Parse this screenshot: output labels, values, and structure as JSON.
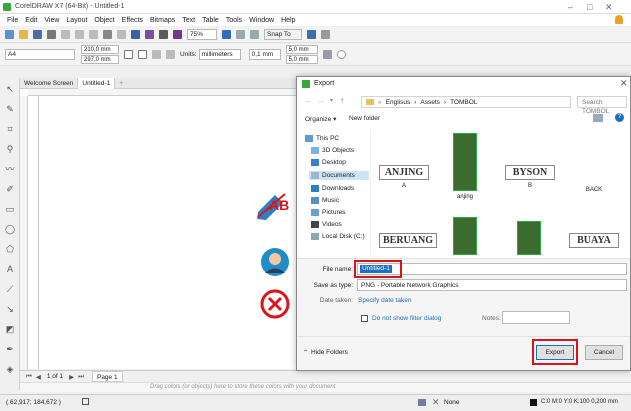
{
  "app": {
    "title": "CorelDRAW X7 (64-Bit) - Untitled-1"
  },
  "menu": [
    "File",
    "Edit",
    "View",
    "Layout",
    "Object",
    "Effects",
    "Bitmaps",
    "Text",
    "Table",
    "Tools",
    "Window",
    "Help"
  ],
  "toolbar": {
    "zoom": "75%",
    "snap": "Snap To",
    "width": "210,0 mm",
    "height": "297,0 mm",
    "units_label": "Units:",
    "units": "millimeters",
    "nudge": "0,1 mm",
    "dup_x": "5,0 mm",
    "dup_y": "5,0 mm",
    "paper": "A4"
  },
  "tabs": [
    "Welcome Screen",
    "Untitled-1"
  ],
  "pagenav": {
    "count": "1 of 1",
    "page": "Page 1"
  },
  "colorstrip": {
    "hint": "Drag colors (or objects) here to store these colors with your document"
  },
  "status": {
    "coords": "( 62,917; 184,672 )",
    "fill": "None",
    "outline": "C:0 M:0 Y:0 K:100  0,200 mm"
  },
  "dialog": {
    "title": "Export",
    "breadcrumb": [
      "Englisus",
      "Assets",
      "TOMBOL"
    ],
    "search_placeholder": "Search TOMBOL",
    "organize": "Organize ▾",
    "new_folder": "New folder",
    "nav": [
      "This PC",
      "3D Objects",
      "Desktop",
      "Documents",
      "Downloads",
      "Music",
      "Pictures",
      "Videos",
      "Local Disk (C:)"
    ],
    "files": [
      {
        "word": "ANJING",
        "label": "A"
      },
      {
        "label": "anjing"
      },
      {
        "word": "BYSON",
        "label": "B"
      },
      {
        "label": "BACK"
      },
      {
        "word": "BERUANG",
        "label": ""
      },
      {
        "label": ""
      },
      {
        "label": ""
      },
      {
        "word": "BUAYA",
        "label": ""
      }
    ],
    "file_name_label": "File name:",
    "file_name": "Untitled-1",
    "save_type_label": "Save as type:",
    "save_type": "PNG - Portable Network Graphics",
    "date_label": "Date taken:",
    "date_value": "Specify date taken",
    "filter_label": "Do not show filter dialog",
    "notes_label": "Notes:",
    "hide_folders": "Hide Folders",
    "export": "Export",
    "cancel": "Cancel"
  },
  "colors": {
    "accent": "#1e6fc0",
    "highlight": "#d9141a",
    "corel_green": "#39a935"
  }
}
